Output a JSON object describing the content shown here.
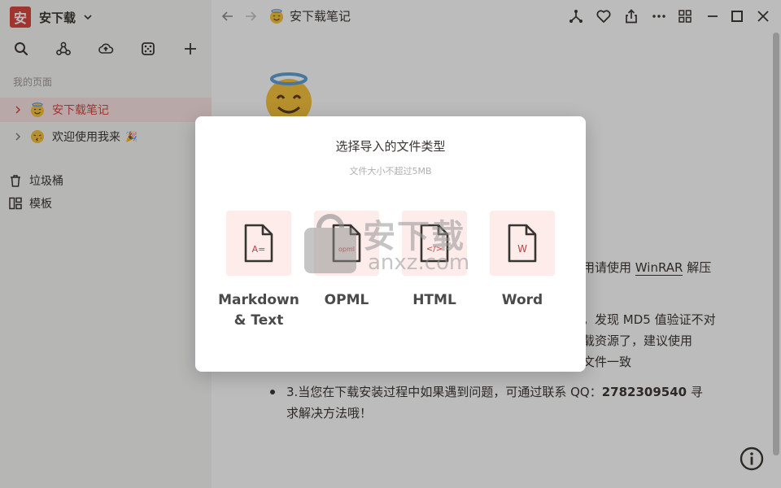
{
  "sidebar": {
    "workspace_logo": "安",
    "workspace_name": "安下载",
    "section_label": "我的页面",
    "pages": [
      {
        "label": "安下载笔记",
        "icon": "halo-smile-emoji",
        "active": true
      },
      {
        "label": "欢迎使用我来",
        "icon": "kiss-emoji",
        "badge": "🎉",
        "active": false
      }
    ],
    "utilities": [
      {
        "label": "垃圾桶",
        "icon": "trash-icon"
      },
      {
        "label": "模板",
        "icon": "template-icon"
      }
    ]
  },
  "topbar": {
    "page_title": "安下载笔记"
  },
  "content": {
    "frag1_text": "用请使用",
    "frag1_link": "WinRAR",
    "frag1_tail": "解压",
    "frag2": "，发现 MD5 值验证不对",
    "frag3": "载资源了，建议使用",
    "frag4": "文件一致",
    "bullet3_pre": "3.当您在下载安装过程中如果遇到问题，可通过联系 QQ：",
    "bullet3_qq": "2782309540",
    "bullet3_post": " 寻",
    "bullet3_line2": "求解决方法哦！"
  },
  "modal": {
    "title": "选择导入的文件类型",
    "subtitle": "文件大小不超过5MB",
    "options": [
      {
        "label": "Markdown\n& Text",
        "glyph": "A="
      },
      {
        "label": "OPML",
        "glyph": "opml"
      },
      {
        "label": "HTML",
        "glyph": "</>"
      },
      {
        "label": "Word",
        "glyph": "W"
      }
    ]
  },
  "watermark": {
    "cn": "安下载",
    "en": "anxz.com"
  },
  "colors": {
    "accent": "#d9453d",
    "active_bg": "#fbe4e3",
    "tile_bg": "#fdecea",
    "sidebar_bg": "#f7f7f5"
  }
}
